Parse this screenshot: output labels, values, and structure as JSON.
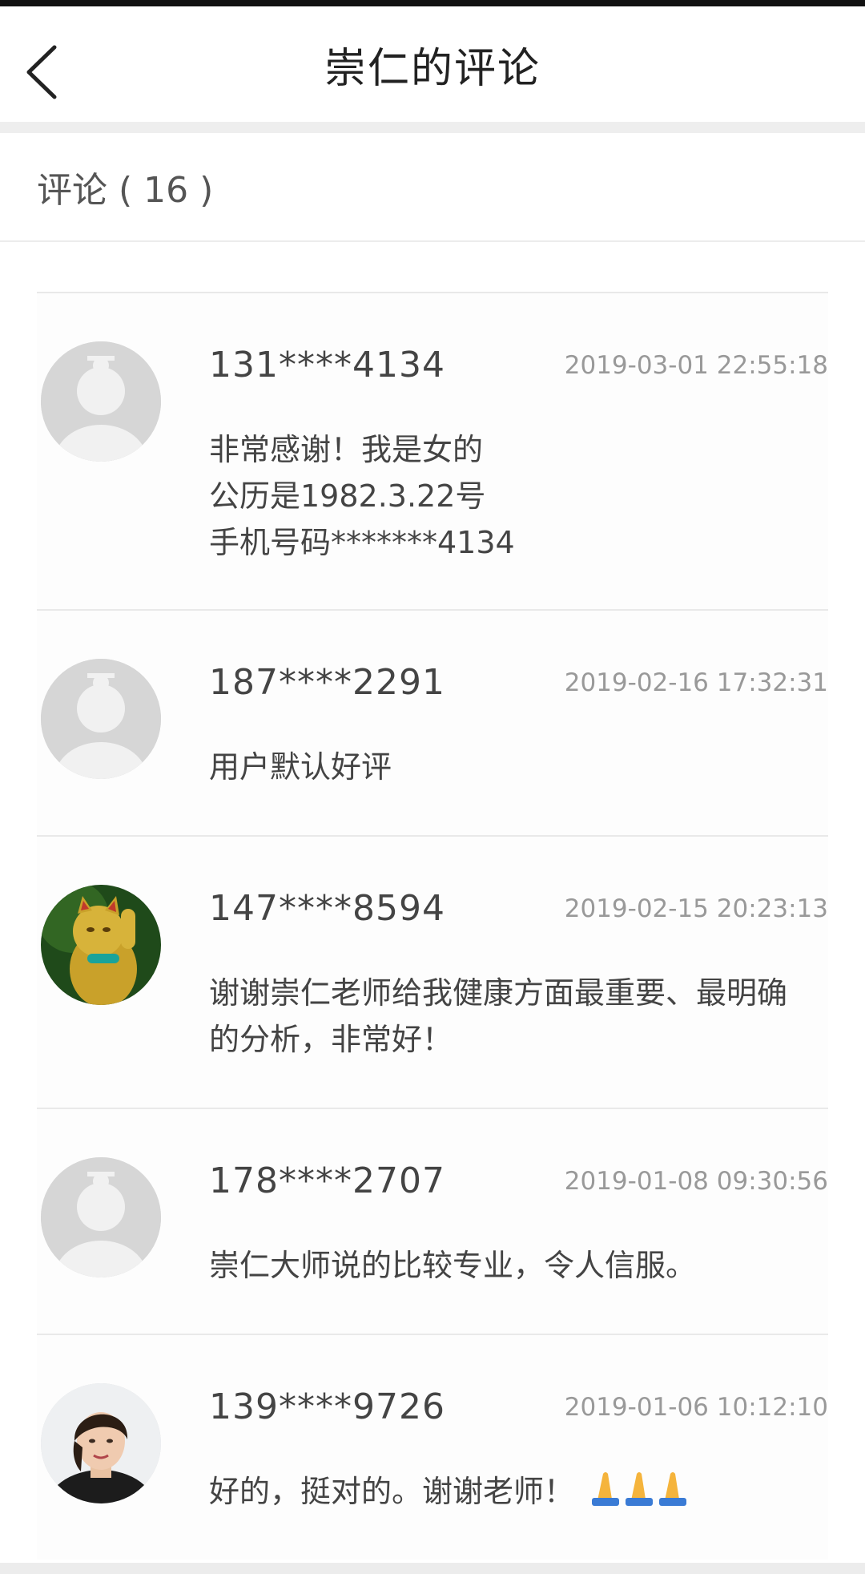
{
  "header": {
    "title": "崇仁的评论"
  },
  "section": {
    "label": "评论 ( 16 )"
  },
  "comments": [
    {
      "user": "131****4134",
      "time": "2019-03-01 22:55:18",
      "lines": [
        "非常感谢！我是女的",
        "公历是1982.3.22号",
        "手机号码*******4134"
      ],
      "avatar": "default-avatar-icon"
    },
    {
      "user": "187****2291",
      "time": "2019-02-16 17:32:31",
      "lines": [
        "用户默认好评"
      ],
      "avatar": "default-avatar-icon"
    },
    {
      "user": "147****8594",
      "time": "2019-02-15 20:23:13",
      "lines": [
        "谢谢崇仁老师给我健康方面最重要、最明确",
        "的分析，非常好！"
      ],
      "avatar": "lucky-cat-avatar"
    },
    {
      "user": "178****2707",
      "time": "2019-01-08 09:30:56",
      "lines": [
        "崇仁大师说的比较专业，令人信服。"
      ],
      "avatar": "default-avatar-icon"
    },
    {
      "user": "139****9726",
      "time": "2019-01-06 10:12:10",
      "lines": [
        "好的，挺对的。谢谢老师！"
      ],
      "avatar": "woman-photo-avatar",
      "emoji": "praying-hands-icon"
    }
  ]
}
